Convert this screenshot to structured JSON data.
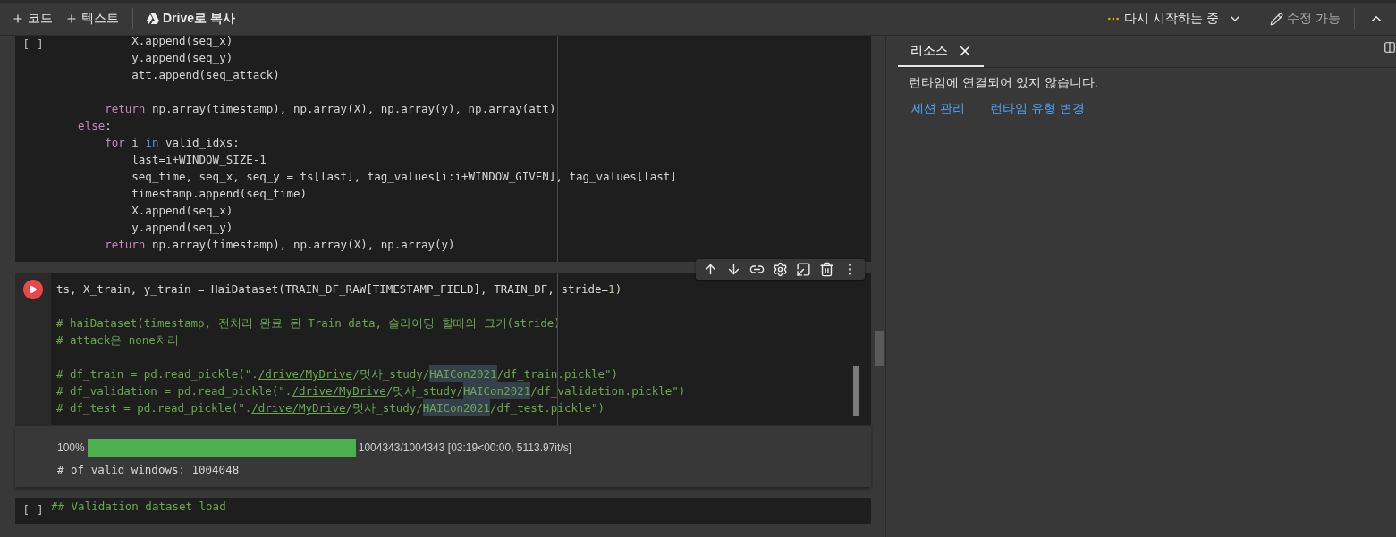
{
  "toolbar": {
    "actions": [
      {
        "kind": "add",
        "label": "코드"
      },
      {
        "kind": "add",
        "label": "텍스트"
      },
      {
        "kind": "drive",
        "label": "Drive로 복사"
      }
    ],
    "status": {
      "label": "다시 시작하는 중"
    },
    "edit": {
      "label": "수정 가능"
    }
  },
  "cells": [
    {
      "prompt": "[ ]",
      "run_button": false,
      "lines": [
        {
          "kind": "code",
          "segments": [
            {
              "text": "            X.append(seq_x)",
              "kind": "plain"
            }
          ]
        },
        {
          "kind": "code",
          "segments": [
            {
              "text": "            y.append(seq_y)",
              "kind": "plain"
            }
          ]
        },
        {
          "kind": "code",
          "segments": [
            {
              "text": "            att.append(seq_attack)",
              "kind": "plain"
            }
          ]
        },
        {
          "kind": "blank"
        },
        {
          "kind": "code",
          "segments": [
            {
              "text": "        return",
              "kind": "keyword"
            },
            {
              "text": " np.array(timestamp), np.array(X), np.array(y), np.array(att)",
              "kind": "plain"
            }
          ]
        },
        {
          "kind": "code",
          "segments": [
            {
              "text": "    else",
              "kind": "keyword"
            },
            {
              "text": ":",
              "kind": "plain"
            }
          ]
        },
        {
          "kind": "code",
          "segments": [
            {
              "text": "        for",
              "kind": "keyword"
            },
            {
              "text": " i ",
              "kind": "plain"
            },
            {
              "text": "in",
              "kind": "builtin"
            },
            {
              "text": " valid_idxs:",
              "kind": "plain"
            }
          ]
        },
        {
          "kind": "code",
          "segments": [
            {
              "text": "            last=i+WINDOW_SIZE-1",
              "kind": "plain"
            }
          ]
        },
        {
          "kind": "code",
          "segments": [
            {
              "text": "            seq_time, seq_x, seq_y = ts[last], tag_values[i:i+WINDOW_GIVEN], tag_values[last]",
              "kind": "plain"
            }
          ]
        },
        {
          "kind": "code",
          "segments": [
            {
              "text": "            timestamp.append(seq_time)",
              "kind": "plain"
            }
          ]
        },
        {
          "kind": "code",
          "segments": [
            {
              "text": "            X.append(seq_x)",
              "kind": "plain"
            }
          ]
        },
        {
          "kind": "code",
          "segments": [
            {
              "text": "            y.append(seq_y)",
              "kind": "plain"
            }
          ]
        },
        {
          "kind": "code",
          "segments": [
            {
              "text": "        return",
              "kind": "keyword"
            },
            {
              "text": " np.array(timestamp), np.array(X), np.array(y)",
              "kind": "plain"
            }
          ]
        }
      ]
    },
    {
      "run_button": true,
      "cell_toolbar": true,
      "lines": [
        {
          "kind": "code",
          "segments": [
            {
              "text": "ts, X_train, y_train = HaiDataset(TRAIN_DF_RAW[TIMESTAMP_FIELD], TRAIN_DF, stride=",
              "kind": "plain"
            },
            {
              "text": "1",
              "kind": "number"
            },
            {
              "text": ")",
              "kind": "plain"
            }
          ]
        },
        {
          "kind": "blank"
        },
        {
          "kind": "code",
          "segments": [
            {
              "text": "# haiDataset(timestamp, 전처리 완료 된 Train data, 슬라이딩 할때의 크기(stride)",
              "kind": "comment"
            }
          ]
        },
        {
          "kind": "code",
          "segments": [
            {
              "text": "# attack은 none처리",
              "kind": "comment"
            }
          ]
        },
        {
          "kind": "blank"
        },
        {
          "kind": "code",
          "segments": [
            {
              "text": "# df_train = pd.read_pickle(\".",
              "kind": "comment"
            },
            {
              "text": "/drive/MyDrive",
              "kind": "link"
            },
            {
              "text": "/멋사_study/",
              "kind": "comment"
            },
            {
              "text": "HAICon2021",
              "kind": "match"
            },
            {
              "text": "/df_train.pickle\")",
              "kind": "comment"
            }
          ]
        },
        {
          "kind": "code",
          "segments": [
            {
              "text": "# df_validation = pd.read_pickle(\".",
              "kind": "comment"
            },
            {
              "text": "/drive/MyDrive",
              "kind": "link"
            },
            {
              "text": "/멋사_study/",
              "kind": "comment"
            },
            {
              "text": "HAICon2021",
              "kind": "match"
            },
            {
              "text": "/df_validation.pickle\")",
              "kind": "comment"
            }
          ]
        },
        {
          "kind": "code",
          "segments": [
            {
              "text": "# df_test = pd.read_pickle(\".",
              "kind": "comment"
            },
            {
              "text": "/drive/MyDrive",
              "kind": "link"
            },
            {
              "text": "/멋사_study/",
              "kind": "comment"
            },
            {
              "text": "HAICon2021",
              "kind": "match"
            },
            {
              "text": "/df_test.pickle\")",
              "kind": "comment"
            }
          ]
        }
      ],
      "output": {
        "progress": {
          "percent": "100%",
          "level": 1,
          "reading": "1004343/1004343 [03:19<00:00, 5113.97it/s]"
        },
        "text": "# of valid windows: 1004048"
      }
    },
    {
      "prompt": "[ ]",
      "run_button": false,
      "lines": [
        {
          "kind": "code",
          "segments": [
            {
              "text": "## Validation dataset load",
              "kind": "comment"
            }
          ]
        }
      ]
    }
  ],
  "panel": {
    "tab": {
      "label": "리소스",
      "selected": true
    },
    "message": "런타임에 연결되어 있지 않습니다.",
    "links": [
      "세션 관리",
      "런타임 유형 변경"
    ]
  }
}
